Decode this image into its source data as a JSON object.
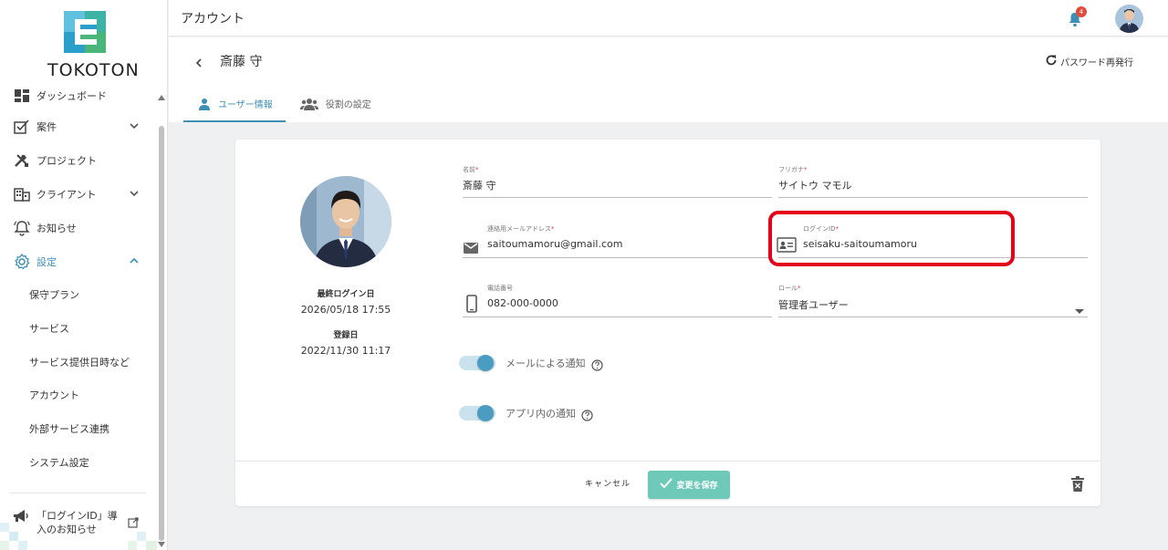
{
  "brand": {
    "name": "TOKOTON"
  },
  "sidebar": {
    "items": [
      {
        "label": "ダッシュボード",
        "icon": "dashboard-icon"
      },
      {
        "label": "案件",
        "icon": "case-icon",
        "expand": "chevron-down"
      },
      {
        "label": "プロジェクト",
        "icon": "tools-icon"
      },
      {
        "label": "クライアント",
        "icon": "building-icon",
        "expand": "chevron-down"
      },
      {
        "label": "お知らせ",
        "icon": "bell-icon"
      },
      {
        "label": "設定",
        "icon": "gear-icon",
        "expand": "chevron-up",
        "active": true
      }
    ],
    "subitems": [
      {
        "label": "保守プラン"
      },
      {
        "label": "サービス"
      },
      {
        "label": "サービス提供日時など"
      },
      {
        "label": "アカウント"
      },
      {
        "label": "外部サービス連携"
      },
      {
        "label": "システム設定"
      }
    ],
    "notice": {
      "label": "「ログインID」導入のお知らせ",
      "icon": "megaphone-icon"
    }
  },
  "topbar": {
    "title": "アカウント",
    "notification_count": "4"
  },
  "header": {
    "name": "斎藤 守",
    "reset_password": "パスワード再発行",
    "tabs": [
      {
        "label": "ユーザー情報",
        "active": true
      },
      {
        "label": "役割の設定",
        "active": false
      }
    ]
  },
  "profile": {
    "last_login_label": "最終ログイン日",
    "last_login_value": "2026/05/18 17:55",
    "registered_label": "登録日",
    "registered_value": "2022/11/30 11:17"
  },
  "form": {
    "name": {
      "label": "名前",
      "value": "斎藤 守"
    },
    "furigana": {
      "label": "フリガナ",
      "value": "サイトウ マモル"
    },
    "email": {
      "label": "連絡用メールアドレス",
      "value": "saitoumamoru@gmail.com"
    },
    "login_id": {
      "label": "ログインID",
      "value": "seisaku-saitoumamoru"
    },
    "phone": {
      "label": "電話番号",
      "value": "082-000-0000"
    },
    "role": {
      "label": "ロール",
      "value": "管理者ユーザー"
    },
    "required_mark": "*",
    "toggles": [
      {
        "label": "メールによる通知",
        "on": true
      },
      {
        "label": "アプリ内の通知",
        "on": true
      }
    ]
  },
  "actions": {
    "cancel": "キャンセル",
    "save": "変更を保存"
  },
  "colors": {
    "accent": "#3d8fb4",
    "save": "#6ec9b9",
    "highlight": "#e3001b",
    "badge": "#e24a3b"
  }
}
